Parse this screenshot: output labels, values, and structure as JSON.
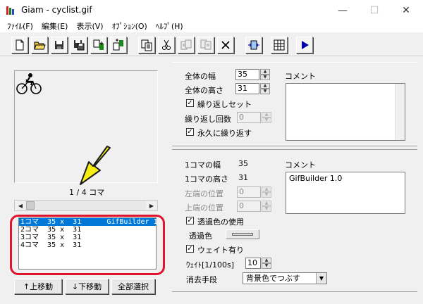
{
  "window": {
    "title": "Giam - cyclist.gif"
  },
  "menu": [
    "ﾌｧｲﾙ(F)",
    "編集(E)",
    "表示(V)",
    "ｵﾌﾟｼｮﾝ(O)",
    "ﾍﾙﾌﾟ(H)"
  ],
  "toolbar_icons": [
    "new-file-icon",
    "open-folder-icon",
    "save-icon",
    "save-as-icon",
    "import-icon",
    "export-icon",
    "copy-icon",
    "cut-icon",
    "paste-before-icon",
    "paste-after-icon",
    "delete-icon",
    "fit-icon",
    "grid-icon",
    "play-icon"
  ],
  "preview": {
    "counter": "1 / 4 コマ"
  },
  "frames": {
    "rows": [
      "1コマ  35 x  31      GifBuilder 1.0",
      "2コマ  35 x  31",
      "3コマ  35 x  31",
      "4コマ  35 x  31"
    ]
  },
  "buttons": {
    "move_up": "↑上移動",
    "move_down": "↓下移動",
    "select_all": "全部選択"
  },
  "global": {
    "width_label": "全体の幅",
    "width_value": "35",
    "height_label": "全体の高さ",
    "height_value": "31",
    "loop_set_label": "繰り返しセット",
    "loop_count_label": "繰り返し回数",
    "loop_count_value": "0",
    "loop_forever_label": "永久に繰り返す",
    "comment_label": "コメント",
    "comment_value": ""
  },
  "frame_props": {
    "width_label": "1コマの幅",
    "width_value": "35",
    "height_label": "1コマの高さ",
    "height_value": "31",
    "left_label": "左端の位置",
    "left_value": "0",
    "top_label": "上端の位置",
    "top_value": "0",
    "use_transparent_label": "透過色の使用",
    "transparent_color_label": "透過色",
    "wait_label": "ウェイト有り",
    "wait_time_label": "ｳｪｲﾄ[1/100s]",
    "wait_time_value": "10",
    "disposal_label": "消去手段",
    "disposal_value": "背景色でつぶす",
    "comment_label": "コメント",
    "comment_value": "GifBuilder 1.0"
  },
  "colors": {
    "highlight": "#0078d7",
    "annotation_red": "#e0152d",
    "annotation_arrow": "#f7ec13"
  }
}
